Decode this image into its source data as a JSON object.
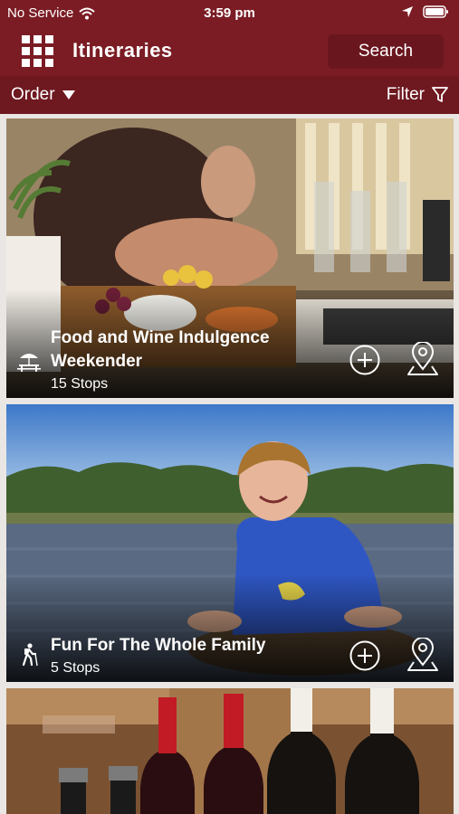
{
  "status_bar": {
    "carrier": "No Service",
    "time": "3:59 pm"
  },
  "header": {
    "title": "Itineraries",
    "search_label": "Search"
  },
  "toolbar": {
    "order_label": "Order",
    "filter_label": "Filter"
  },
  "itineraries": [
    {
      "name": "Food and Wine Indulgence Weekender",
      "stops": "15 Stops",
      "category_icon": "picnic-table-icon"
    },
    {
      "name": "Fun For The Whole Family",
      "stops": "5 Stops",
      "category_icon": "hiker-icon"
    }
  ],
  "colors": {
    "brand": "#7b1c24",
    "subbar": "#6e1820"
  }
}
